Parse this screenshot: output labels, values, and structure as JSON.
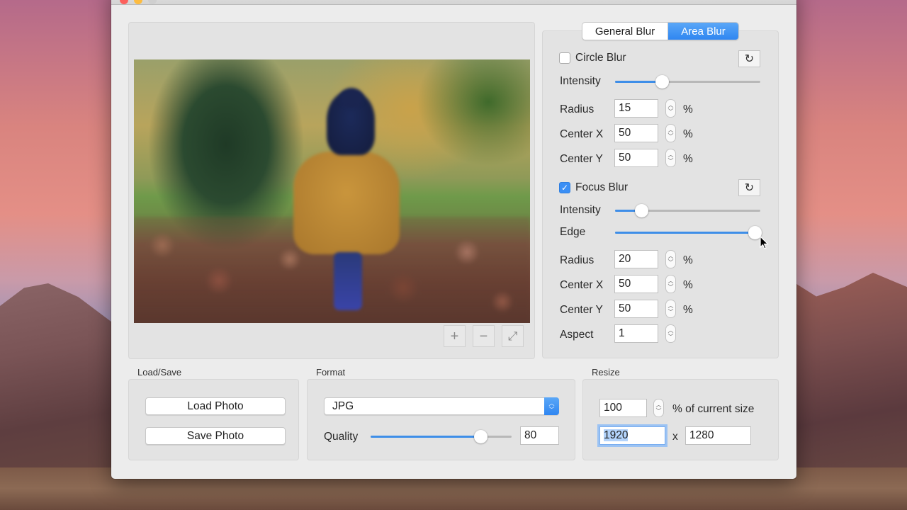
{
  "window": {
    "traffic_lights": [
      "close",
      "minimize",
      "maximize"
    ]
  },
  "preview": {
    "image_description": "Blurred photo of a child in a yellow coat and navy knit hat walking on autumn leaves",
    "zoom_in_icon": "+",
    "zoom_out_icon": "−",
    "fit_icon": "⤢"
  },
  "tabs": {
    "items": [
      {
        "label": "General Blur",
        "active": false
      },
      {
        "label": "Area Blur",
        "active": true
      }
    ]
  },
  "circle_blur": {
    "label": "Circle Blur",
    "checked": false,
    "reset_icon": "↻",
    "intensity_label": "Intensity",
    "intensity_fraction": 0.32,
    "radius_label": "Radius",
    "radius_value": "15",
    "center_x_label": "Center X",
    "center_x_value": "50",
    "center_y_label": "Center Y",
    "center_y_value": "50",
    "unit": "%"
  },
  "focus_blur": {
    "label": "Focus Blur",
    "checked": true,
    "check_glyph": "✓",
    "reset_icon": "↻",
    "intensity_label": "Intensity",
    "intensity_fraction": 0.18,
    "edge_label": "Edge",
    "edge_fraction": 0.96,
    "radius_label": "Radius",
    "radius_value": "20",
    "center_x_label": "Center X",
    "center_x_value": "50",
    "center_y_label": "Center Y",
    "center_y_value": "50",
    "aspect_label": "Aspect",
    "aspect_value": "1",
    "unit": "%"
  },
  "stepper_glyphs": {
    "up": "︿",
    "down": "﹀"
  },
  "load_save": {
    "title": "Load/Save",
    "load_label": "Load Photo",
    "save_label": "Save Photo"
  },
  "format": {
    "title": "Format",
    "selected": "JPG",
    "quality_label": "Quality",
    "quality_value": "80",
    "quality_fraction": 0.78
  },
  "resize": {
    "title": "Resize",
    "percent_value": "100",
    "percent_label": "% of current size",
    "width_value": "1920",
    "times": "x",
    "height_value": "1280"
  },
  "colors": {
    "accent": "#2f86f1",
    "window_bg": "#ececec",
    "box_bg": "#e3e3e3"
  }
}
